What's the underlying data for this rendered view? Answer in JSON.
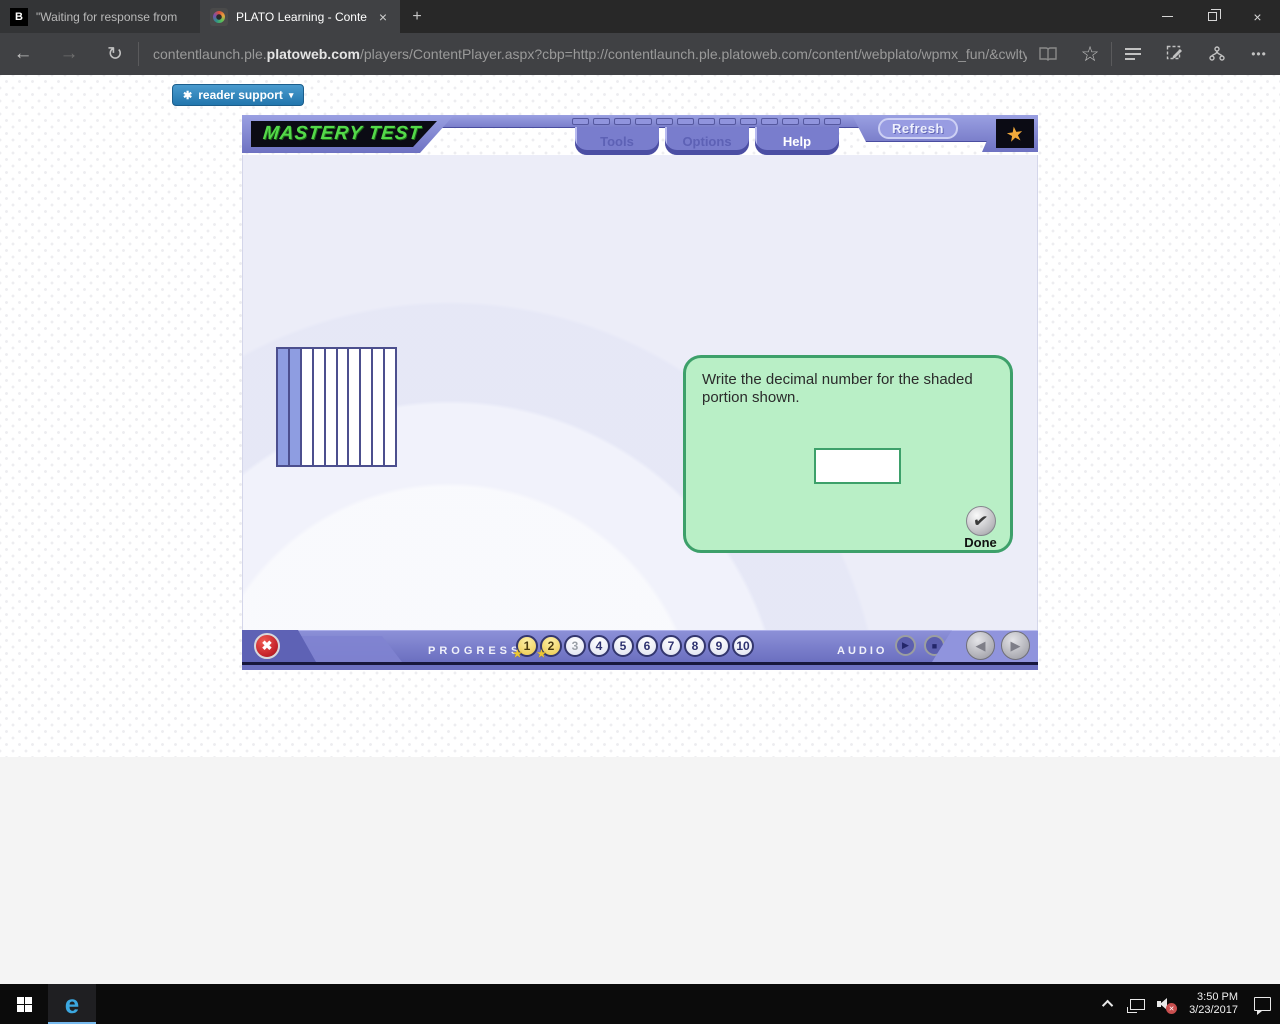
{
  "icons": {
    "back": "←",
    "forward": "→",
    "refresh": "↻",
    "favorites_star": "☆",
    "more": "•••",
    "close_tab": "×",
    "close_window": "×",
    "new_tab": "+",
    "gear": "✱",
    "caret_down": "▾",
    "star_solid": "★",
    "play": "▶",
    "stop": "■",
    "nav_back": "◀",
    "nav_forward": "▶",
    "check": "✔",
    "close_x": "✖",
    "mute_x": "✕"
  },
  "browser": {
    "tabs": [
      {
        "favicon_letter": "B",
        "title": "\"Waiting for response from"
      },
      {
        "title": "PLATO Learning - Conte"
      }
    ],
    "url": {
      "prefix": "contentlaunch.ple.",
      "domain": "platoweb.com",
      "rest": "/players/ContentPlayer.aspx?cbp=http://contentlaunch.ple.platoweb.com/content/webplato/wpmx_fun/&cwltype"
    }
  },
  "page": {
    "reader_support_label": "reader support"
  },
  "player": {
    "logo_text": "MASTERY TEST",
    "nav_tabs": [
      {
        "label": "Tools",
        "active": false
      },
      {
        "label": "Options",
        "active": false
      },
      {
        "label": "Help",
        "active": true
      }
    ],
    "refresh_label": "Refresh",
    "header_segment_count": 13,
    "diagram": {
      "total_strips": 10,
      "shaded_strips": 2,
      "shaded_color": "#8e9de1",
      "border_color": "#4c4f8e"
    },
    "question": {
      "text": "Write the decimal number for the shaded portion shown.",
      "input_value": "",
      "done_label": "Done"
    },
    "progress": {
      "label": "PROGRESS",
      "items": [
        {
          "n": "1",
          "state": "completed"
        },
        {
          "n": "2",
          "state": "completed"
        },
        {
          "n": "3",
          "state": "current"
        },
        {
          "n": "4",
          "state": "upcoming"
        },
        {
          "n": "5",
          "state": "upcoming"
        },
        {
          "n": "6",
          "state": "upcoming"
        },
        {
          "n": "7",
          "state": "upcoming"
        },
        {
          "n": "8",
          "state": "upcoming"
        },
        {
          "n": "9",
          "state": "upcoming"
        },
        {
          "n": "10",
          "state": "upcoming"
        }
      ]
    },
    "audio_label": "AUDIO",
    "colors": {
      "panel_green": "#b9efc6",
      "panel_border": "#3da06a",
      "purple": "#7b7fcb",
      "gold": "#ecc94e"
    }
  },
  "taskbar": {
    "time": "3:50 PM",
    "date": "3/23/2017"
  }
}
